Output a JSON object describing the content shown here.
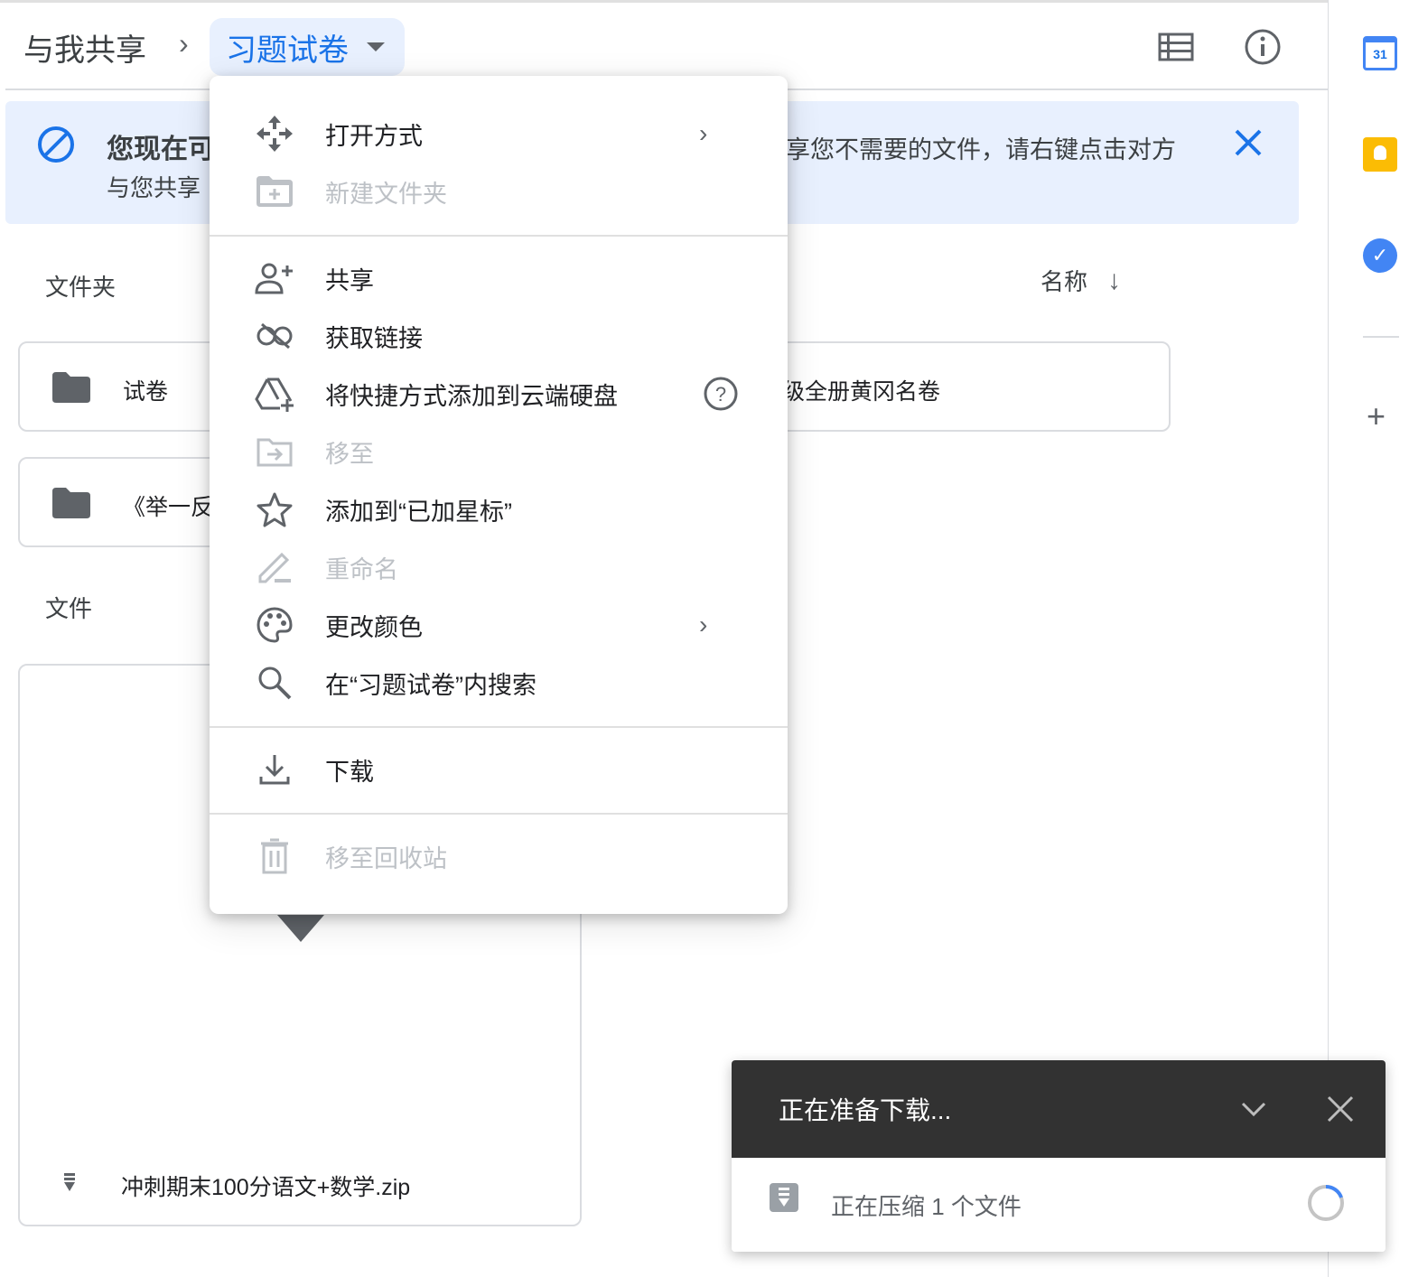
{
  "breadcrumb": {
    "root": "与我共享",
    "current": "习题试卷"
  },
  "banner": {
    "title_visible": "您现在可",
    "subtitle_visible": "与您共享",
    "text_right_visible": "享您不需要的文件，请右键点击对方"
  },
  "folders_section": {
    "label": "文件夹",
    "sort_label": "名称"
  },
  "folders": [
    {
      "name": "试卷"
    },
    {
      "name": "级全册黄冈名卷"
    },
    {
      "name": "《举一反"
    }
  ],
  "files_section": {
    "label": "文件"
  },
  "files": [
    {
      "name": "冲刺期末100分语文+数学.zip"
    }
  ],
  "menu": {
    "items": [
      {
        "label": "打开方式",
        "icon": "open-with-icon",
        "disabled": false,
        "submenu": true
      },
      {
        "label": "新建文件夹",
        "icon": "new-folder-icon",
        "disabled": true
      },
      {
        "label": "共享",
        "icon": "person-add-icon",
        "disabled": false
      },
      {
        "label": "获取链接",
        "icon": "link-icon",
        "disabled": false
      },
      {
        "label": "将快捷方式添加到云端硬盘",
        "icon": "add-shortcut-icon",
        "disabled": false,
        "help": true
      },
      {
        "label": "移至",
        "icon": "move-to-icon",
        "disabled": true
      },
      {
        "label": "添加到“已加星标”",
        "icon": "star-icon",
        "disabled": false
      },
      {
        "label": "重命名",
        "icon": "rename-icon",
        "disabled": true
      },
      {
        "label": "更改颜色",
        "icon": "palette-icon",
        "disabled": false,
        "submenu": true
      },
      {
        "label": "在“习题试卷”内搜索",
        "icon": "search-icon",
        "disabled": false
      },
      {
        "label": "下载",
        "icon": "download-icon",
        "disabled": false
      },
      {
        "label": "移至回收站",
        "icon": "trash-icon",
        "disabled": true
      }
    ]
  },
  "download": {
    "title": "正在准备下载...",
    "status": "正在压缩 1 个文件"
  },
  "sidepanel": {
    "calendar_day": "31"
  },
  "colors": {
    "accent": "#1a73e8",
    "banner": "#e8f0fe",
    "toast": "#323232"
  }
}
